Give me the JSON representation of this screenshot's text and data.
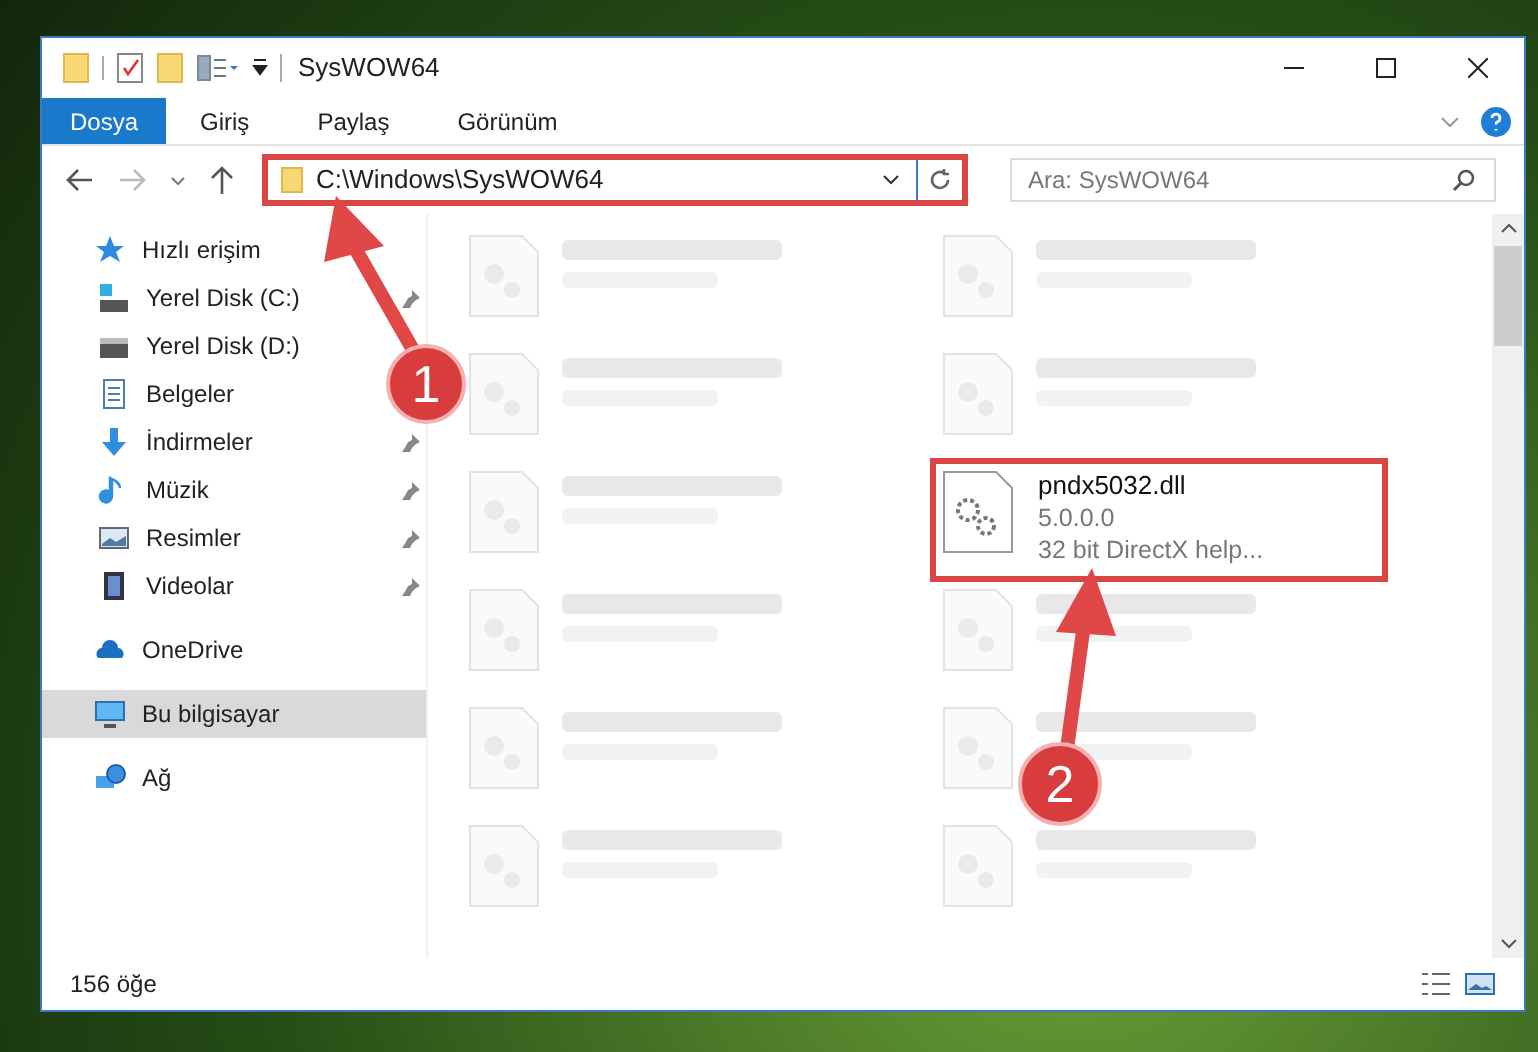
{
  "window": {
    "title": "SysWOW64"
  },
  "ribbon_tabs": [
    {
      "label": "Dosya",
      "selected": true
    },
    {
      "label": "Giriş",
      "selected": false
    },
    {
      "label": "Paylaş",
      "selected": false
    },
    {
      "label": "Görünüm",
      "selected": false
    }
  ],
  "address": {
    "value": "C:\\Windows\\SysWOW64"
  },
  "search": {
    "placeholder": "Ara: SysWOW64"
  },
  "sidebar": {
    "items": [
      {
        "label": "Hızlı erişim",
        "kind": "star",
        "selected": false,
        "children": [
          {
            "label": "Yerel Disk (C:)",
            "kind": "drive-c",
            "pinned": true,
            "selected": false
          },
          {
            "label": "Yerel Disk (D:)",
            "kind": "drive",
            "selected": false
          },
          {
            "label": "Belgeler",
            "kind": "docs",
            "selected": false
          },
          {
            "label": "İndirmeler",
            "kind": "download",
            "pinned": true,
            "selected": false
          },
          {
            "label": "Müzik",
            "kind": "music",
            "pinned": true,
            "selected": false
          },
          {
            "label": "Resimler",
            "kind": "pictures",
            "pinned": true,
            "selected": false
          },
          {
            "label": "Videolar",
            "kind": "videos",
            "pinned": true,
            "selected": false
          }
        ]
      },
      {
        "label": "OneDrive",
        "kind": "cloud",
        "selected": false
      },
      {
        "label": "Bu bilgisayar",
        "kind": "pc",
        "selected": true
      },
      {
        "label": "Ağ",
        "kind": "network",
        "selected": false
      }
    ]
  },
  "files": [
    {
      "kind": "blurred"
    },
    {
      "kind": "blurred"
    },
    {
      "kind": "blurred"
    },
    {
      "kind": "blurred"
    },
    {
      "kind": "blurred"
    },
    {
      "kind": "file",
      "name": "pndx5032.dll",
      "lines": [
        "5.0.0.0",
        "32 bit DirectX help..."
      ]
    },
    {
      "kind": "blurred"
    },
    {
      "kind": "blurred"
    },
    {
      "kind": "blurred"
    },
    {
      "kind": "blurred"
    },
    {
      "kind": "blurred"
    },
    {
      "kind": "blurred"
    }
  ],
  "status_bar": {
    "item_count": "156 öğe"
  },
  "annotations": [
    {
      "number": "1"
    },
    {
      "number": "2"
    }
  ]
}
